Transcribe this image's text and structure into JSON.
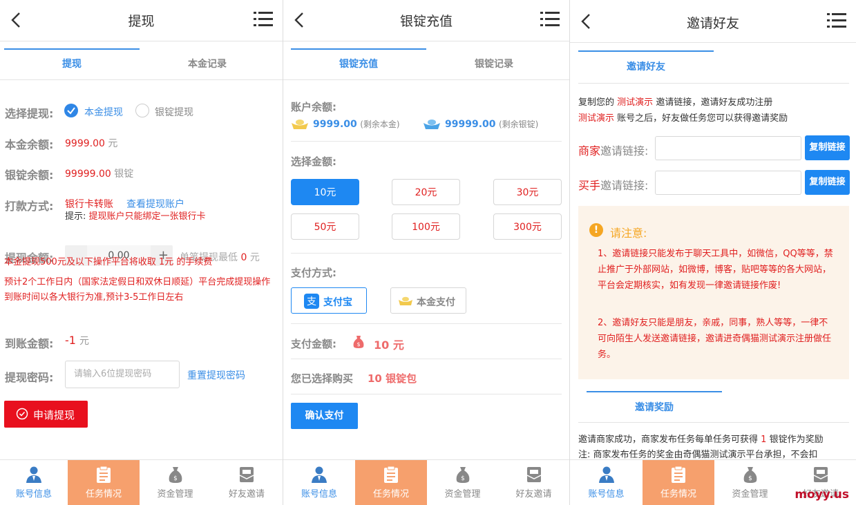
{
  "panel1": {
    "title": "提现",
    "tabs": [
      "提现",
      "本金记录"
    ],
    "choose_label": "选择提现:",
    "option_principal": "本金提现",
    "option_ingot": "银锭提现",
    "principal_label": "本金余额:",
    "principal_value": "9999.00",
    "principal_unit": "元",
    "ingot_label": "银锭余额:",
    "ingot_value": "99999.00",
    "ingot_unit": "银锭",
    "pay_label": "打款方式:",
    "pay_method": "银行卡转账",
    "view_account": "查看提现账户",
    "hint_prefix": "提示:",
    "hint_text": "提现账户只能绑定一张银行卡",
    "amount_label": "提现金额:",
    "amount_value": "0.00",
    "amount_plus": "+",
    "min_text": "单笔提现最低",
    "min_value": "0",
    "min_unit": "元",
    "fee_text": "本金提现500元及以下操作平台将收取 1元 的手续费",
    "time_text": "预计2个工作日内（国家法定假日和双休日顺延）平台完成提现操作 到账时间以各大银行为准,预计3-5工作日左右",
    "arrive_label": "到账金额:",
    "arrive_value": "-1",
    "arrive_unit": "元",
    "pwd_label": "提现密码:",
    "pwd_placeholder": "请输入6位提现密码",
    "reset_pwd": "重置提现密码",
    "submit": "申请提现"
  },
  "panel2": {
    "title": "银锭充值",
    "tabs": [
      "银锭充值",
      "银锭记录"
    ],
    "balance_label": "账户余额:",
    "principal_value": "9999.00",
    "principal_note": "(剩余本金)",
    "ingot_value": "99999.00",
    "ingot_note": "(剩余银锭)",
    "choose_label": "选择金额:",
    "amounts": [
      "10元",
      "20元",
      "30元",
      "50元",
      "100元",
      "300元"
    ],
    "pay_label": "支付方式:",
    "alipay": "支付宝",
    "principal_pay": "本金支付",
    "pay_amount_label": "支付金额:",
    "pay_amount_value": "10 元",
    "selected_label": "您已选择购买",
    "selected_value": "10 银锭包",
    "confirm": "确认支付"
  },
  "panel3": {
    "title": "邀请好友",
    "tab": "邀请好友",
    "intro_1": "复制您的",
    "intro_2": "测试演示",
    "intro_3": "邀请链接，邀请好友成功注册",
    "intro_4": "测试演示",
    "intro_5": "账号之后，好友做任务您可以获得邀请奖励",
    "merchant_label_red": "商家",
    "merchant_label": "邀请链接:",
    "buyer_label_red": "买手",
    "buyer_label": "邀请链接:",
    "copy": "复制链接",
    "notice_title": "请注意:",
    "notice_1": "1、邀请链接只能发布于聊天工具中，如微信，QQ等等，禁止推广于外部网站，如微博，博客，贴吧等等的各大网站，平台会定期核实，如有发现一律邀请链接作废!",
    "notice_2": "2、邀请好友只能是朋友，亲戚，同事，熟人等等，一律不可向陌生人发送邀请链接，邀请进奇偶猫测试演示注册做任务。",
    "reward_title": "邀请奖励",
    "reward_1": "邀请商家成功，商家发布任务每单任务可获得",
    "reward_1_value": "1",
    "reward_1_end": "银锭作为奖励",
    "reward_2": "注: 商家发布任务的奖金由奇偶猫测试演示平台承担，不会扣",
    "watermark": "moyy.us"
  },
  "footer": [
    "账号信息",
    "任务情况",
    "资金管理",
    "好友邀请"
  ],
  "colors": {
    "accent": "#3a8ee6",
    "red": "#e02020",
    "active_nav": "#f6a06d",
    "button_blue": "#1e88f2"
  }
}
